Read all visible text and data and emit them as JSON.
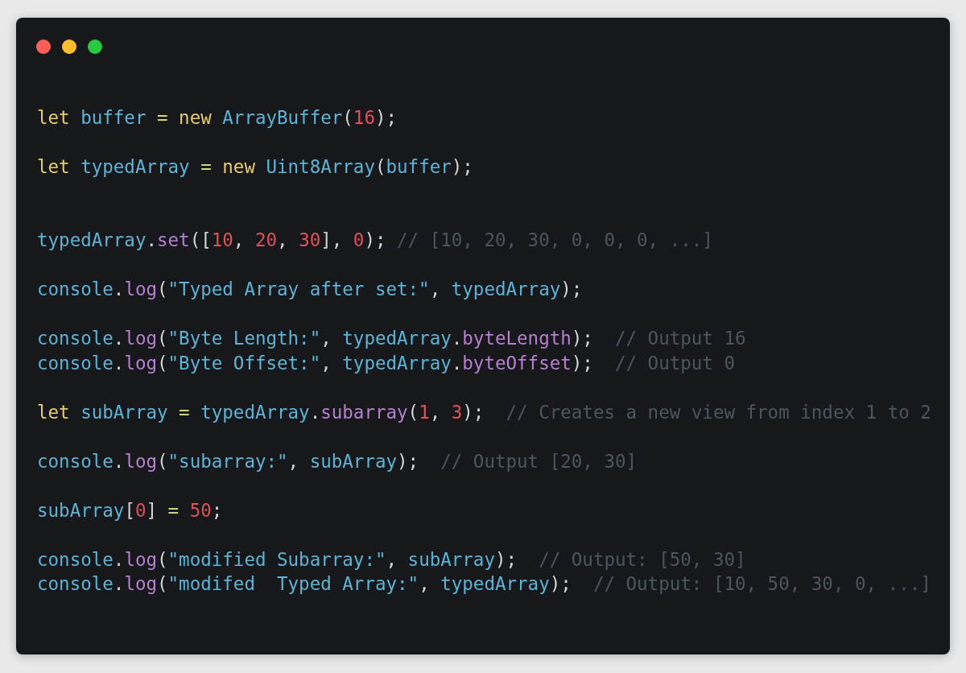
{
  "window": {
    "controls": [
      {
        "color": "#ff5f57"
      },
      {
        "color": "#febc2e"
      },
      {
        "color": "#28c840"
      }
    ]
  },
  "code": {
    "lines": [
      {
        "kind": "blank"
      },
      {
        "kind": "code",
        "tokens": [
          {
            "kind": "keyword",
            "text": "let "
          },
          {
            "kind": "name",
            "text": "buffer "
          },
          {
            "kind": "operator",
            "text": "= "
          },
          {
            "kind": "keyword",
            "text": "new "
          },
          {
            "kind": "name",
            "text": "ArrayBuffer"
          },
          {
            "kind": "punct",
            "text": "("
          },
          {
            "kind": "number",
            "text": "16"
          },
          {
            "kind": "punct",
            "text": ");"
          }
        ]
      },
      {
        "kind": "blank"
      },
      {
        "kind": "code",
        "tokens": [
          {
            "kind": "keyword",
            "text": "let "
          },
          {
            "kind": "name",
            "text": "typedArray "
          },
          {
            "kind": "operator",
            "text": "= "
          },
          {
            "kind": "keyword",
            "text": "new "
          },
          {
            "kind": "name",
            "text": "Uint8Array"
          },
          {
            "kind": "punct",
            "text": "("
          },
          {
            "kind": "name",
            "text": "buffer"
          },
          {
            "kind": "punct",
            "text": ");"
          }
        ]
      },
      {
        "kind": "blank"
      },
      {
        "kind": "blank"
      },
      {
        "kind": "code",
        "tokens": [
          {
            "kind": "name",
            "text": "typedArray"
          },
          {
            "kind": "punct",
            "text": "."
          },
          {
            "kind": "method",
            "text": "set"
          },
          {
            "kind": "punct",
            "text": "(["
          },
          {
            "kind": "number",
            "text": "10"
          },
          {
            "kind": "punct",
            "text": ", "
          },
          {
            "kind": "number",
            "text": "20"
          },
          {
            "kind": "punct",
            "text": ", "
          },
          {
            "kind": "number",
            "text": "30"
          },
          {
            "kind": "punct",
            "text": "], "
          },
          {
            "kind": "number",
            "text": "0"
          },
          {
            "kind": "punct",
            "text": "); "
          },
          {
            "kind": "comment",
            "text": "// [10, 20, 30, 0, 0, 0, ...]"
          }
        ]
      },
      {
        "kind": "blank"
      },
      {
        "kind": "code",
        "tokens": [
          {
            "kind": "name",
            "text": "console"
          },
          {
            "kind": "punct",
            "text": "."
          },
          {
            "kind": "method",
            "text": "log"
          },
          {
            "kind": "punct",
            "text": "("
          },
          {
            "kind": "string",
            "text": "\"Typed Array after set:\""
          },
          {
            "kind": "punct",
            "text": ", "
          },
          {
            "kind": "name",
            "text": "typedArray"
          },
          {
            "kind": "punct",
            "text": ");"
          }
        ]
      },
      {
        "kind": "blank"
      },
      {
        "kind": "code",
        "tokens": [
          {
            "kind": "name",
            "text": "console"
          },
          {
            "kind": "punct",
            "text": "."
          },
          {
            "kind": "method",
            "text": "log"
          },
          {
            "kind": "punct",
            "text": "("
          },
          {
            "kind": "string",
            "text": "\"Byte Length:\""
          },
          {
            "kind": "punct",
            "text": ", "
          },
          {
            "kind": "name",
            "text": "typedArray"
          },
          {
            "kind": "punct",
            "text": "."
          },
          {
            "kind": "method",
            "text": "byteLength"
          },
          {
            "kind": "punct",
            "text": ");  "
          },
          {
            "kind": "comment",
            "text": "// Output 16"
          }
        ]
      },
      {
        "kind": "code",
        "tokens": [
          {
            "kind": "name",
            "text": "console"
          },
          {
            "kind": "punct",
            "text": "."
          },
          {
            "kind": "method",
            "text": "log"
          },
          {
            "kind": "punct",
            "text": "("
          },
          {
            "kind": "string",
            "text": "\"Byte Offset:\""
          },
          {
            "kind": "punct",
            "text": ", "
          },
          {
            "kind": "name",
            "text": "typedArray"
          },
          {
            "kind": "punct",
            "text": "."
          },
          {
            "kind": "method",
            "text": "byteOffset"
          },
          {
            "kind": "punct",
            "text": ");  "
          },
          {
            "kind": "comment",
            "text": "// Output 0"
          }
        ]
      },
      {
        "kind": "blank"
      },
      {
        "kind": "code",
        "tokens": [
          {
            "kind": "keyword",
            "text": "let "
          },
          {
            "kind": "name",
            "text": "subArray "
          },
          {
            "kind": "operator",
            "text": "= "
          },
          {
            "kind": "name",
            "text": "typedArray"
          },
          {
            "kind": "punct",
            "text": "."
          },
          {
            "kind": "method",
            "text": "subarray"
          },
          {
            "kind": "punct",
            "text": "("
          },
          {
            "kind": "number",
            "text": "1"
          },
          {
            "kind": "punct",
            "text": ", "
          },
          {
            "kind": "number",
            "text": "3"
          },
          {
            "kind": "punct",
            "text": ");  "
          },
          {
            "kind": "comment",
            "text": "// Creates a new view from index 1 to 2"
          }
        ]
      },
      {
        "kind": "blank"
      },
      {
        "kind": "code",
        "tokens": [
          {
            "kind": "name",
            "text": "console"
          },
          {
            "kind": "punct",
            "text": "."
          },
          {
            "kind": "method",
            "text": "log"
          },
          {
            "kind": "punct",
            "text": "("
          },
          {
            "kind": "string",
            "text": "\"subarray:\""
          },
          {
            "kind": "punct",
            "text": ", "
          },
          {
            "kind": "name",
            "text": "subArray"
          },
          {
            "kind": "punct",
            "text": ");  "
          },
          {
            "kind": "comment",
            "text": "// Output [20, 30]"
          }
        ]
      },
      {
        "kind": "blank"
      },
      {
        "kind": "code",
        "tokens": [
          {
            "kind": "name",
            "text": "subArray"
          },
          {
            "kind": "punct",
            "text": "["
          },
          {
            "kind": "number",
            "text": "0"
          },
          {
            "kind": "punct",
            "text": "] "
          },
          {
            "kind": "operator",
            "text": "= "
          },
          {
            "kind": "number",
            "text": "50"
          },
          {
            "kind": "punct",
            "text": ";"
          }
        ]
      },
      {
        "kind": "blank"
      },
      {
        "kind": "code",
        "tokens": [
          {
            "kind": "name",
            "text": "console"
          },
          {
            "kind": "punct",
            "text": "."
          },
          {
            "kind": "method",
            "text": "log"
          },
          {
            "kind": "punct",
            "text": "("
          },
          {
            "kind": "string",
            "text": "\"modified Subarray:\""
          },
          {
            "kind": "punct",
            "text": ", "
          },
          {
            "kind": "name",
            "text": "subArray"
          },
          {
            "kind": "punct",
            "text": ");  "
          },
          {
            "kind": "comment",
            "text": "// Output: [50, 30]"
          }
        ]
      },
      {
        "kind": "code",
        "tokens": [
          {
            "kind": "name",
            "text": "console"
          },
          {
            "kind": "punct",
            "text": "."
          },
          {
            "kind": "method",
            "text": "log"
          },
          {
            "kind": "punct",
            "text": "("
          },
          {
            "kind": "string",
            "text": "\"modifed  Typed Array:\""
          },
          {
            "kind": "punct",
            "text": ", "
          },
          {
            "kind": "name",
            "text": "typedArray"
          },
          {
            "kind": "punct",
            "text": ");  "
          },
          {
            "kind": "comment",
            "text": "// Output: [10, 50, 30, 0, ...]"
          }
        ]
      }
    ]
  }
}
